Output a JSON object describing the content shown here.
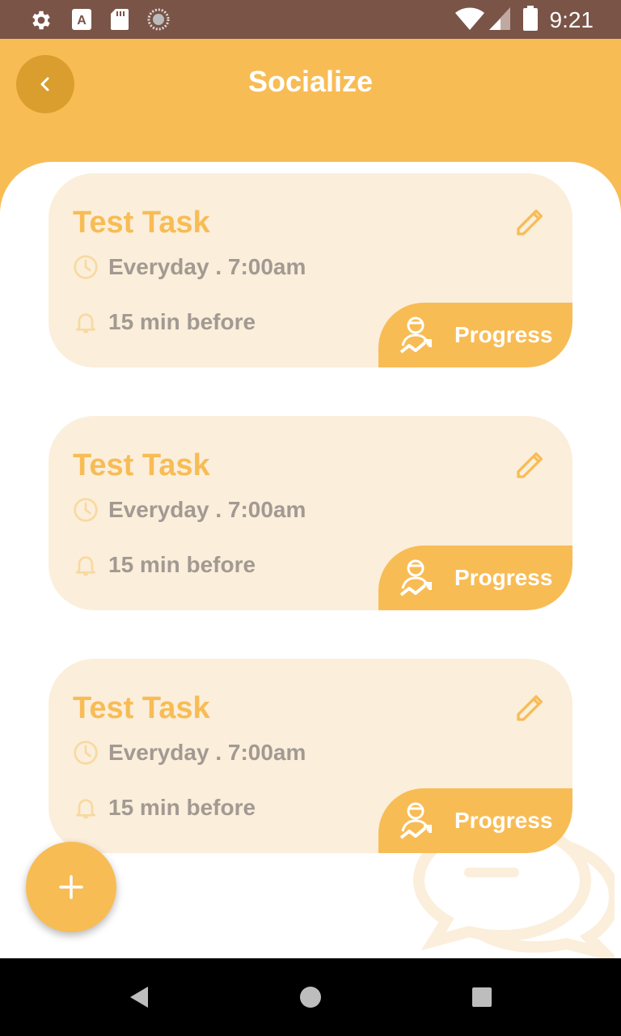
{
  "status_bar": {
    "time": "9:21",
    "icons": [
      "settings-icon",
      "a-icon",
      "sd-card-icon",
      "sync-icon",
      "wifi-icon",
      "signal-icon",
      "battery-icon"
    ]
  },
  "header": {
    "title": "Socialize",
    "back_icon": "chevron-left-icon"
  },
  "colors": {
    "accent": "#f8bc55",
    "status_bar": "#7a5447",
    "card_bg": "#fbeedb",
    "back_button": "#d99e2e",
    "muted_text": "#a29a92"
  },
  "tasks": [
    {
      "title": "Test Task",
      "schedule": "Everyday . 7:00am",
      "reminder": "15 min before",
      "progress_label": "Progress"
    },
    {
      "title": "Test Task",
      "schedule": "Everyday . 7:00am",
      "reminder": "15 min before",
      "progress_label": "Progress"
    },
    {
      "title": "Test Task",
      "schedule": "Everyday . 7:00am",
      "reminder": "15 min before",
      "progress_label": "Progress"
    }
  ],
  "fab": {
    "icon": "plus-icon"
  },
  "background_decoration": "chat-bubbles-icon",
  "nav": {
    "icons": [
      "back-triangle-icon",
      "home-circle-icon",
      "recents-square-icon"
    ]
  }
}
